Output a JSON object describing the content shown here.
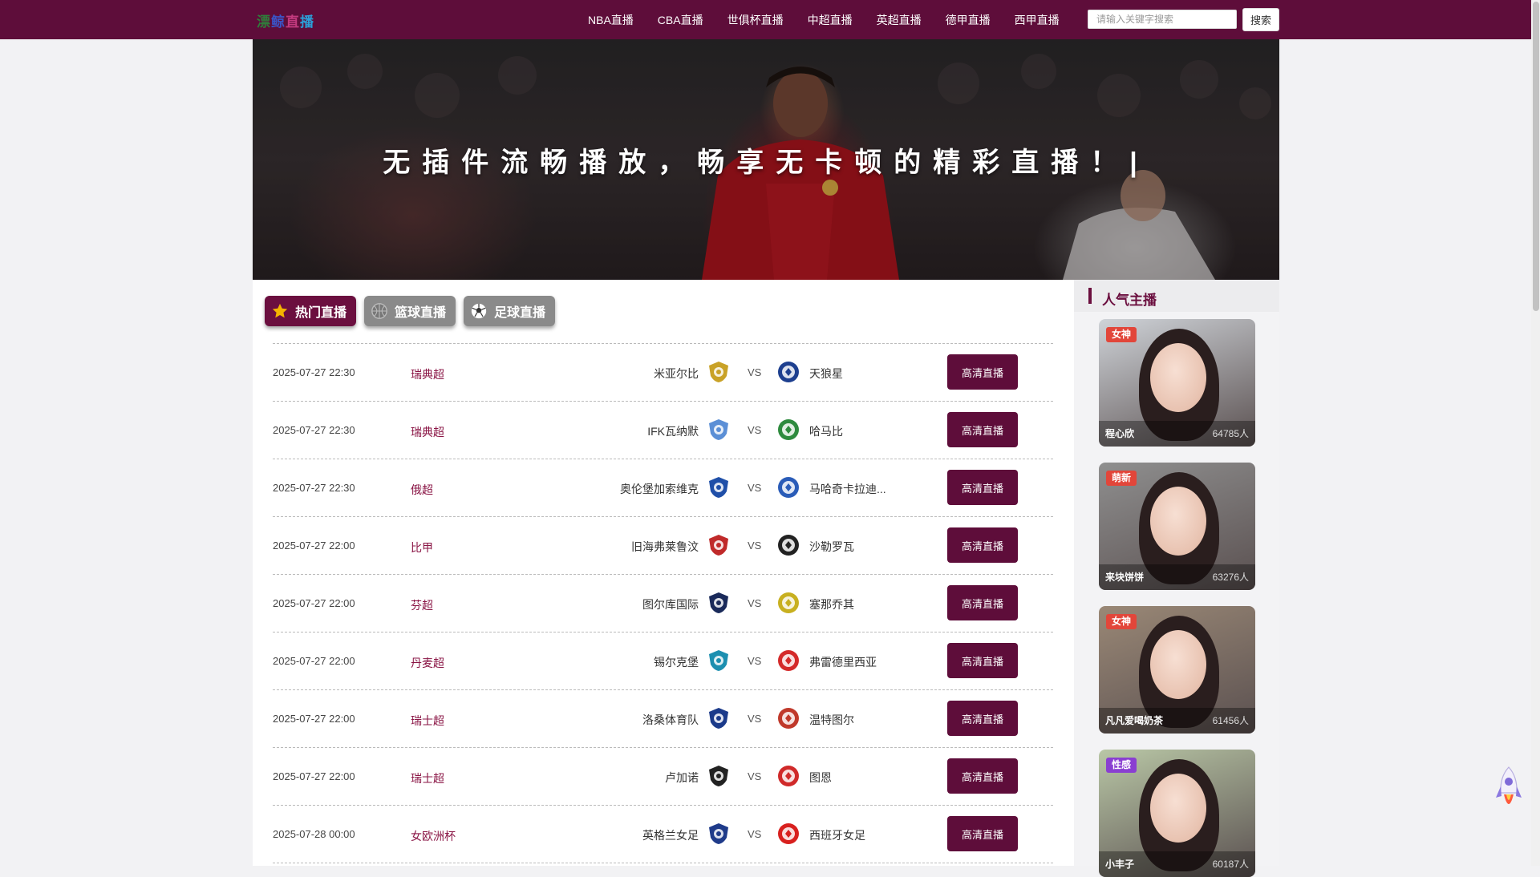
{
  "header": {
    "logo_chars": [
      "漂",
      "鲸",
      "直",
      "播"
    ],
    "nav": [
      "NBA直播",
      "CBA直播",
      "世俱杯直播",
      "中超直播",
      "英超直播",
      "德甲直播",
      "西甲直播"
    ],
    "search_placeholder": "请输入关键字搜索",
    "search_button": "搜索"
  },
  "banner": {
    "slogan": "无插件流畅播放，畅享无卡顿的精彩直播！|"
  },
  "tabs": [
    {
      "label": "热门直播",
      "icon": "star-icon",
      "active": true
    },
    {
      "label": "篮球直播",
      "icon": "basketball-icon",
      "active": false
    },
    {
      "label": "足球直播",
      "icon": "soccer-ball-icon",
      "active": false
    }
  ],
  "matches": [
    {
      "time": "2025-07-27 22:30",
      "league": "瑞典超",
      "home": "米亚尔比",
      "away": "天狼星",
      "button": "高清直播",
      "home_color": "#c9a227",
      "away_color": "#1d3f8f"
    },
    {
      "time": "2025-07-27 22:30",
      "league": "瑞典超",
      "home": "IFK瓦纳默",
      "away": "哈马比",
      "button": "高清直播",
      "home_color": "#5b8fd6",
      "away_color": "#2e8b3e"
    },
    {
      "time": "2025-07-27 22:30",
      "league": "俄超",
      "home": "奥伦堡加索维克",
      "away": "马哈奇卡拉迪...",
      "button": "高清直播",
      "home_color": "#1f4fa8",
      "away_color": "#2a5cb8"
    },
    {
      "time": "2025-07-27 22:00",
      "league": "比甲",
      "home": "旧海弗莱鲁汶",
      "away": "沙勒罗瓦",
      "button": "高清直播",
      "home_color": "#c02a2a",
      "away_color": "#222222"
    },
    {
      "time": "2025-07-27 22:00",
      "league": "芬超",
      "home": "图尔库国际",
      "away": "塞那乔其",
      "button": "高清直播",
      "home_color": "#1a2a5a",
      "away_color": "#c8b020"
    },
    {
      "time": "2025-07-27 22:00",
      "league": "丹麦超",
      "home": "锡尔克堡",
      "away": "弗雷德里西亚",
      "button": "高清直播",
      "home_color": "#1c8fb0",
      "away_color": "#d42a2a"
    },
    {
      "time": "2025-07-27 22:00",
      "league": "瑞士超",
      "home": "洛桑体育队",
      "away": "温特图尔",
      "button": "高清直播",
      "home_color": "#1b3a8a",
      "away_color": "#c0392b"
    },
    {
      "time": "2025-07-27 22:00",
      "league": "瑞士超",
      "home": "卢加诺",
      "away": "图恩",
      "button": "高清直播",
      "home_color": "#222222",
      "away_color": "#d02a2a"
    },
    {
      "time": "2025-07-28 00:00",
      "league": "女欧洲杯",
      "home": "英格兰女足",
      "away": "西班牙女足",
      "button": "高清直播",
      "home_color": "#1f3b8a",
      "away_color": "#d8201e"
    }
  ],
  "match_vs": "VS",
  "sidebar": {
    "title": "人气主播",
    "anchors": [
      {
        "badge": "女神",
        "badge_color": "#e2463a",
        "name": "程心欣",
        "count": "64785人",
        "bg": "#cfd3d8"
      },
      {
        "badge": "萌新",
        "badge_color": "#e2463a",
        "name": "来块饼饼",
        "count": "63276人",
        "bg": "#8f8f8f"
      },
      {
        "badge": "女神",
        "badge_color": "#e2463a",
        "name": "凡凡爱喝奶茶",
        "count": "61456人",
        "bg": "#9a8876"
      },
      {
        "badge": "性感",
        "badge_color": "#8a3fd1",
        "name": "小丰子",
        "count": "60187人",
        "bg": "#b9c7a6"
      }
    ]
  }
}
